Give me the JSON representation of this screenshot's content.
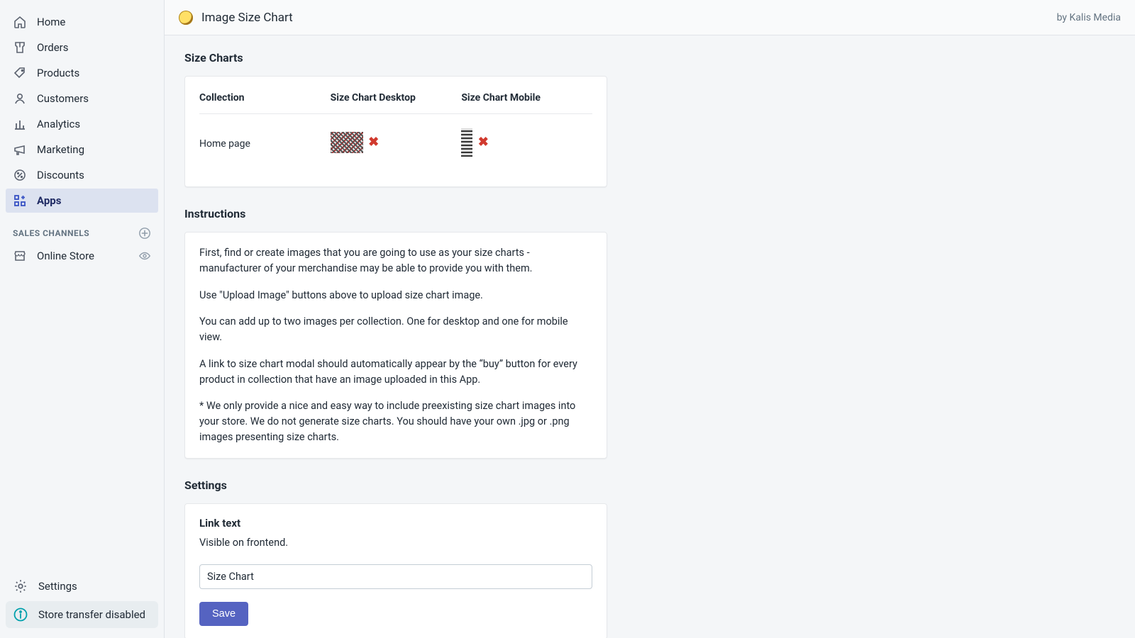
{
  "sidebar": {
    "nav": [
      {
        "label": "Home",
        "icon": "home-icon"
      },
      {
        "label": "Orders",
        "icon": "orders-icon"
      },
      {
        "label": "Products",
        "icon": "products-icon"
      },
      {
        "label": "Customers",
        "icon": "customers-icon"
      },
      {
        "label": "Analytics",
        "icon": "analytics-icon"
      },
      {
        "label": "Marketing",
        "icon": "marketing-icon"
      },
      {
        "label": "Discounts",
        "icon": "discounts-icon"
      },
      {
        "label": "Apps",
        "icon": "apps-icon",
        "active": true
      }
    ],
    "channels_header": "SALES CHANNELS",
    "channels": [
      {
        "label": "Online Store",
        "icon": "store-icon"
      }
    ],
    "bottom": {
      "settings_label": "Settings",
      "transfer_label": "Store transfer disabled"
    }
  },
  "header": {
    "title": "Image Size Chart",
    "byline": "by Kalis Media"
  },
  "size_charts": {
    "heading": "Size Charts",
    "columns": {
      "collection": "Collection",
      "desktop": "Size Chart Desktop",
      "mobile": "Size Chart Mobile"
    },
    "rows": [
      {
        "collection": "Home page"
      }
    ]
  },
  "instructions": {
    "heading": "Instructions",
    "paragraphs": [
      "First, find or create images that you are going to use as your size charts - manufacturer of your merchandise may be able to provide you with them.",
      "Use \"Upload Image\" buttons above to upload size chart image.",
      "You can add up to two images per collection. One for desktop and one for mobile view.",
      "A link to size chart modal should automatically appear by the “buy” button for every product in collection that have an image uploaded in this App.",
      "* We only provide a nice and easy way to include preexisting size chart images into your store. We do not generate size charts. You should have your own .jpg or .png images presenting size charts."
    ]
  },
  "settings": {
    "heading": "Settings",
    "link_text_label": "Link text",
    "link_text_desc": "Visible on frontend.",
    "link_text_value": "Size Chart",
    "save_label": "Save"
  }
}
